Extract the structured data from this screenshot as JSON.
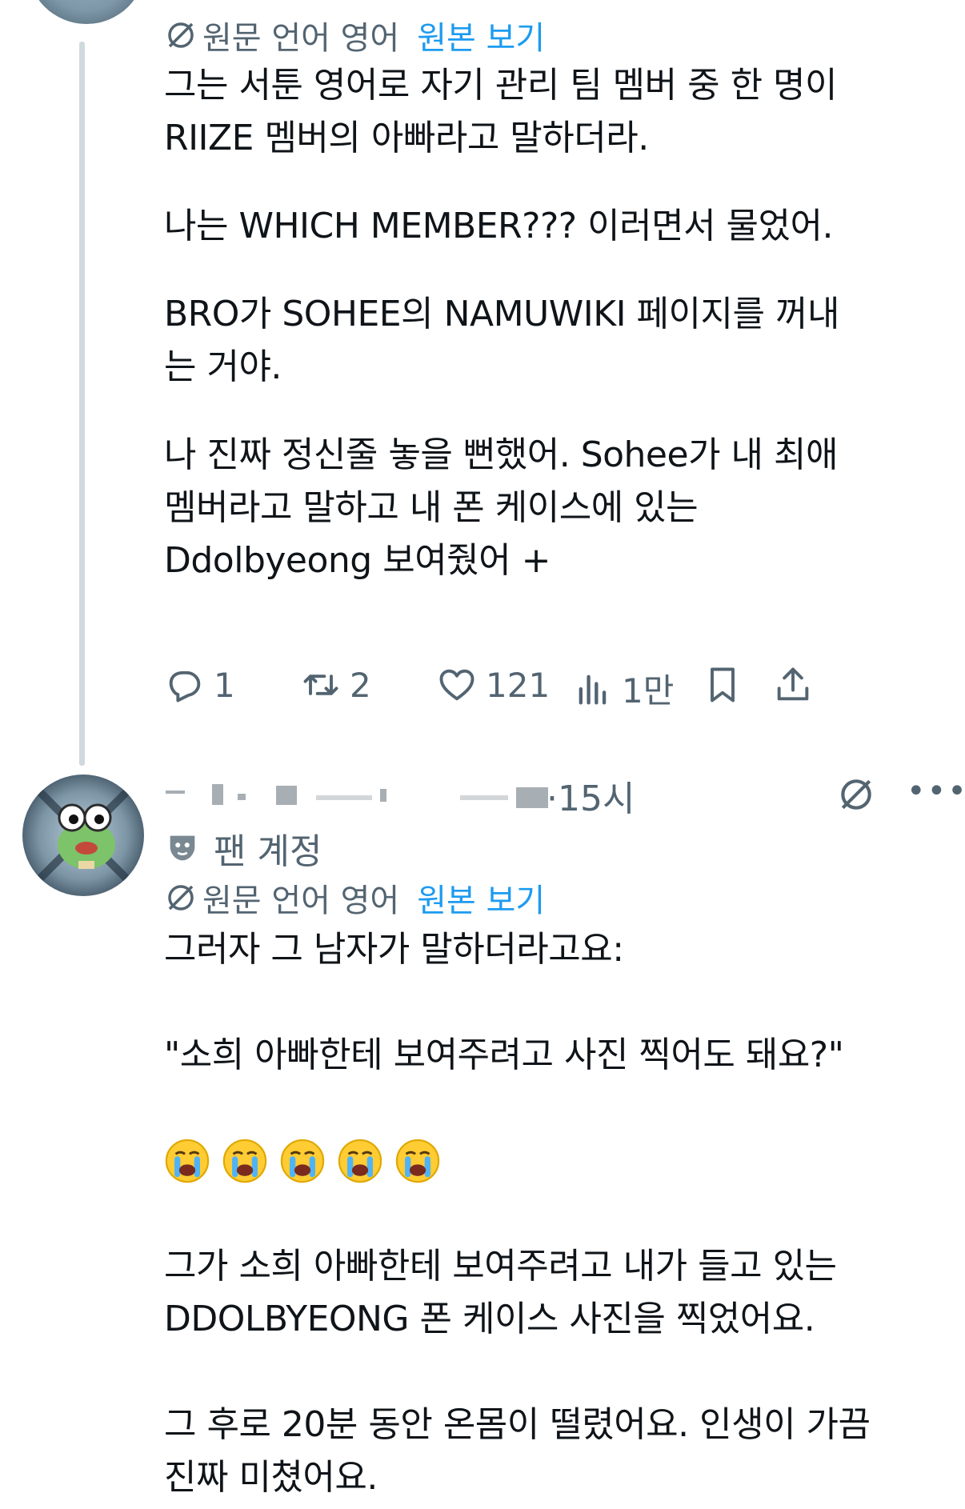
{
  "tweet1": {
    "translate": {
      "lang_label": "원문 언어 영어",
      "show_original": "원본 보기"
    },
    "paragraphs": [
      "그는 서툰 영어로 자기 관리 팀 멤버 중 한 명이\nRIIZE 멤버의 아빠라고 말하더라.",
      "나는 WHICH MEMBER??? 이러면서 물었어.",
      "BRO가 SOHEE의 NAMUWIKI 페이지를 꺼내\n는 거야.",
      "나 진짜 정신줄 놓을 뻔했어. Sohee가 내 최애\n멤버라고 말하고 내 폰 케이스에 있는\nDdolbyeong 보여줬어 +"
    ],
    "actions": {
      "reply_count": "1",
      "retweet_count": "2",
      "like_count": "121",
      "view_count": "1만"
    }
  },
  "tweet2": {
    "time": "·15시",
    "more_label": "•••",
    "fan_label": "팬 계정",
    "translate": {
      "lang_label": "원문 언어 영어",
      "show_original": "원본 보기"
    },
    "paragraphs": [
      "그러자 그 남자가 말하더라고요:",
      "\"소희 아빠한테 보여주려고 사진 찍어도 돼요?\""
    ],
    "emoji_count": 5,
    "paragraphs_after": [
      "그가 소희 아빠한테 보여주려고 내가 들고 있는\nDDOLBYEONG 폰 케이스 사진을 찍었어요.",
      "그 후로 20분 동안 온몸이 떨렸어요. 인생이 가끔\n진짜 미쳤어요."
    ]
  },
  "colors": {
    "secondary_text": "#536471",
    "link": "#1d9bf0",
    "thread_line": "#cfd9de"
  },
  "icons": [
    "translate-icon",
    "reply-icon",
    "retweet-icon",
    "like-icon",
    "views-icon",
    "bookmark-icon",
    "share-icon",
    "more-icon",
    "fan-mask-icon",
    "crying-face-icon"
  ]
}
